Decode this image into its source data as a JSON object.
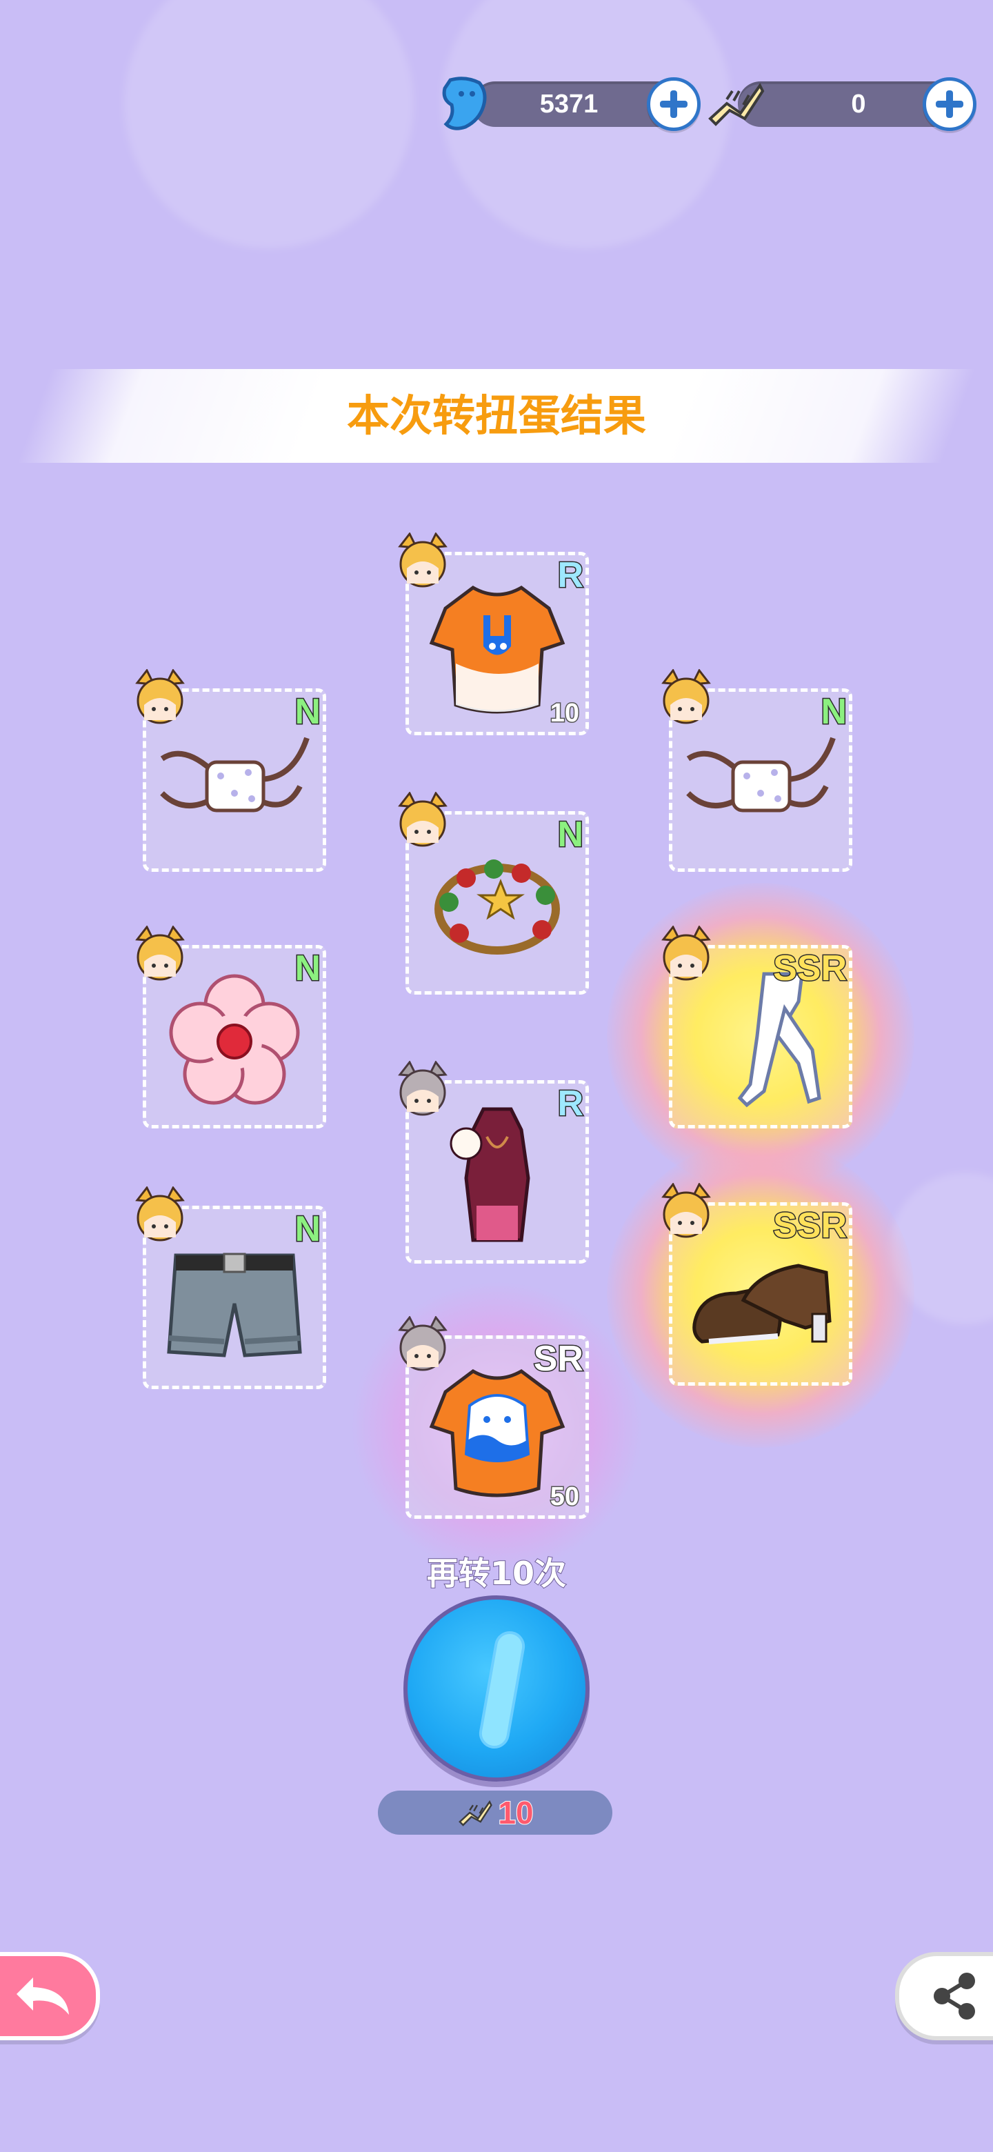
{
  "currency": {
    "gems": {
      "value": "5371",
      "icon": "blue-gem-icon"
    },
    "tickets": {
      "value": "0",
      "icon": "fishbone-ticket-icon"
    }
  },
  "banner": {
    "title": "本次转扭蛋结果"
  },
  "items": [
    {
      "id": "orange-rabbit-tshirt",
      "rarity": "R",
      "quantity": "10",
      "character": "blonde-fox-girl"
    },
    {
      "id": "dotted-mask-1",
      "rarity": "N",
      "quantity": "",
      "character": "blonde-fox-girl"
    },
    {
      "id": "dotted-mask-2",
      "rarity": "N",
      "quantity": "",
      "character": "blonde-fox-girl"
    },
    {
      "id": "bead-bracelet",
      "rarity": "N",
      "quantity": "",
      "character": "blonde-fox-girl"
    },
    {
      "id": "pink-flower",
      "rarity": "N",
      "quantity": "",
      "character": "blonde-fox-girl"
    },
    {
      "id": "white-tights",
      "rarity": "SSR",
      "quantity": "",
      "character": "blonde-fox-girl"
    },
    {
      "id": "qipao-dress",
      "rarity": "R",
      "quantity": "",
      "character": "grey-cat-girl"
    },
    {
      "id": "denim-shorts",
      "rarity": "N",
      "quantity": "",
      "character": "blonde-fox-girl"
    },
    {
      "id": "brown-mary-janes",
      "rarity": "SSR",
      "quantity": "",
      "character": "blonde-fox-girl"
    },
    {
      "id": "orange-wave-tshirt",
      "rarity": "SR",
      "quantity": "50",
      "character": "grey-cat-girl"
    }
  ],
  "spin": {
    "label": "再转10次",
    "cost": "10"
  },
  "colors": {
    "background": "#c9bdf6",
    "title": "#f79c0f",
    "spin_button": "#1ea8f4",
    "back_button": "#ff7a9e"
  }
}
